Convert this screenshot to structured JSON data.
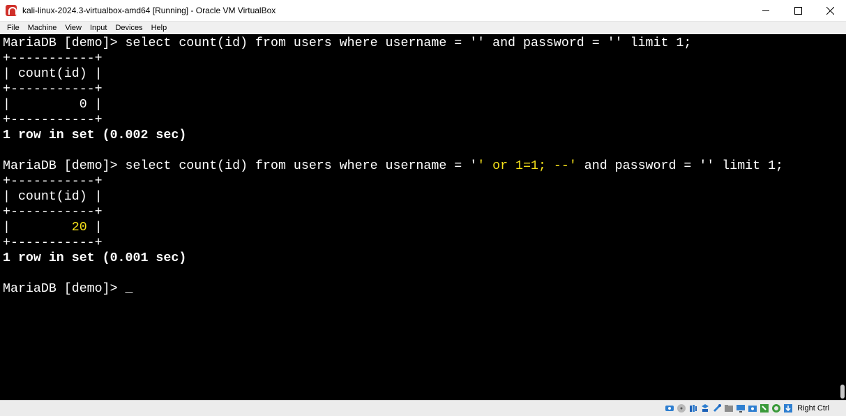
{
  "window": {
    "title": "kali-linux-2024.3-virtualbox-amd64 [Running] - Oracle VM VirtualBox",
    "controls": [
      "minimize-icon",
      "maximize-icon",
      "close-icon"
    ]
  },
  "menu": [
    "File",
    "Machine",
    "View",
    "Input",
    "Devices",
    "Help"
  ],
  "terminal": {
    "line0": "MariaDB [demo]> select count(id) from users where username = '' and password = '' limit 1;",
    "line1": "+-----------+",
    "line2": "| count(id) |",
    "line3": "+-----------+",
    "line4": "|         0 |",
    "line5": "+-----------+",
    "line6": "1 row in set (0.002 sec)",
    "line7": "",
    "line8a": "MariaDB [demo]> select count(id) from users where username = '",
    "line8b": "' or 1=1; --'",
    "line8c": " and password = '' limit 1;",
    "line9": "+-----------+",
    "line10": "| count(id) |",
    "line11": "+-----------+",
    "line12a": "|        ",
    "line12b": "20",
    "line12c": " |",
    "line13": "+-----------+",
    "line14": "1 row in set (0.001 sec)",
    "line15": "",
    "line16": "MariaDB [demo]> ",
    "cursor": "_",
    "highlight_color": "#f5e01a"
  },
  "statusbar": {
    "icons": [
      "hard-disk-icon",
      "optical-drive-icon",
      "audio-icon",
      "network-icon",
      "usb-icon",
      "shared-folders-icon",
      "display-icon",
      "video-capture-icon",
      "mouse-integration-icon",
      "keyboard-icon",
      "cpu-icon",
      "arrow-down-icon"
    ],
    "host_key": "Right Ctrl"
  }
}
